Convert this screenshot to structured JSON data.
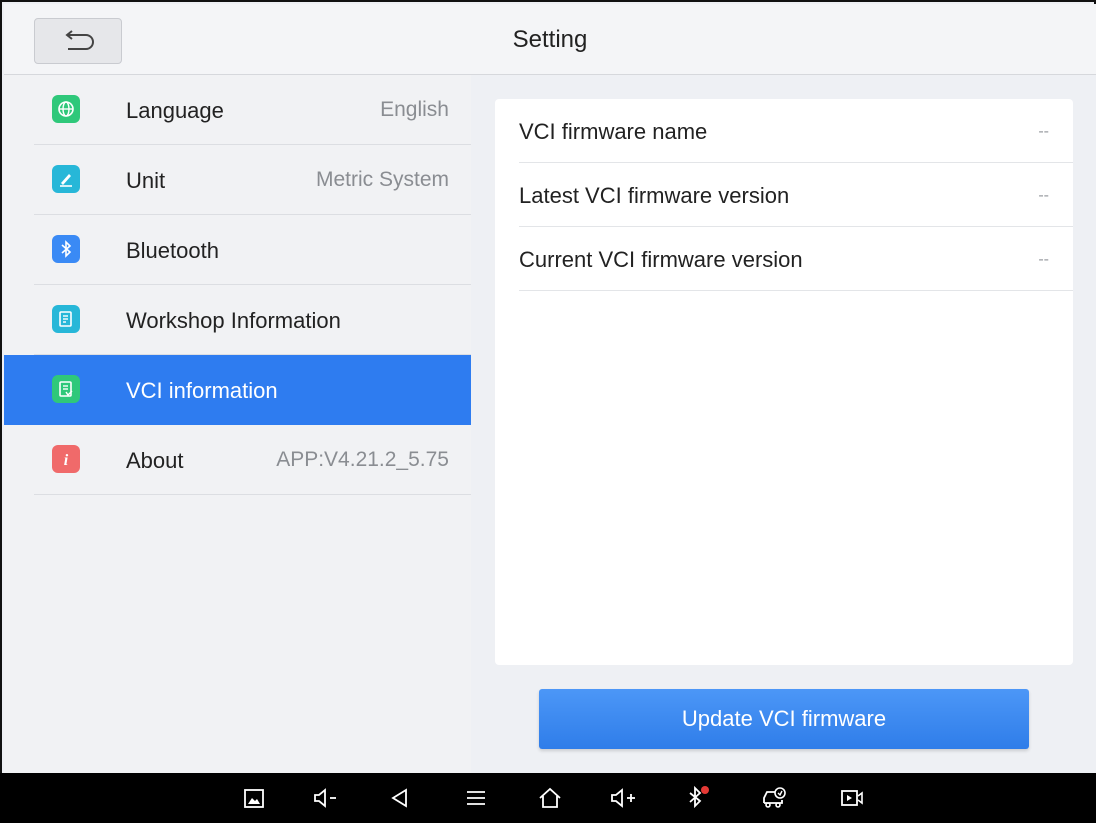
{
  "header": {
    "title": "Setting"
  },
  "sidebar": {
    "items": [
      {
        "label": "Language",
        "value": "English",
        "icon": "globe-icon",
        "color": "#2fc87a"
      },
      {
        "label": "Unit",
        "value": "Metric System",
        "icon": "pencil-icon",
        "color": "#27b7d8"
      },
      {
        "label": "Bluetooth",
        "value": "",
        "icon": "bluetooth-icon",
        "color": "#3a8af5"
      },
      {
        "label": "Workshop Information",
        "value": "",
        "icon": "document-icon",
        "color": "#27b7d8"
      },
      {
        "label": "VCI information",
        "value": "",
        "icon": "vci-document-icon",
        "color": "#2fc87a"
      },
      {
        "label": "About",
        "value": "APP:V4.21.2_5.75",
        "icon": "info-icon",
        "color": "#f06a6a"
      }
    ],
    "active_index": 4,
    "accent_color": "#2e7cf0"
  },
  "main": {
    "rows": [
      {
        "label": "VCI firmware name",
        "value": "--"
      },
      {
        "label": "Latest VCI firmware version",
        "value": "--"
      },
      {
        "label": "Current VCI firmware version",
        "value": "--"
      }
    ],
    "update_button": "Update VCI firmware"
  },
  "navbar": {
    "buttons": [
      "screenshot-icon",
      "volume-down-icon",
      "back-icon",
      "menu-icon",
      "home-icon",
      "volume-up-icon",
      "bluetooth-disconnected-icon",
      "car-diagnostics-icon",
      "screen-record-icon"
    ]
  }
}
